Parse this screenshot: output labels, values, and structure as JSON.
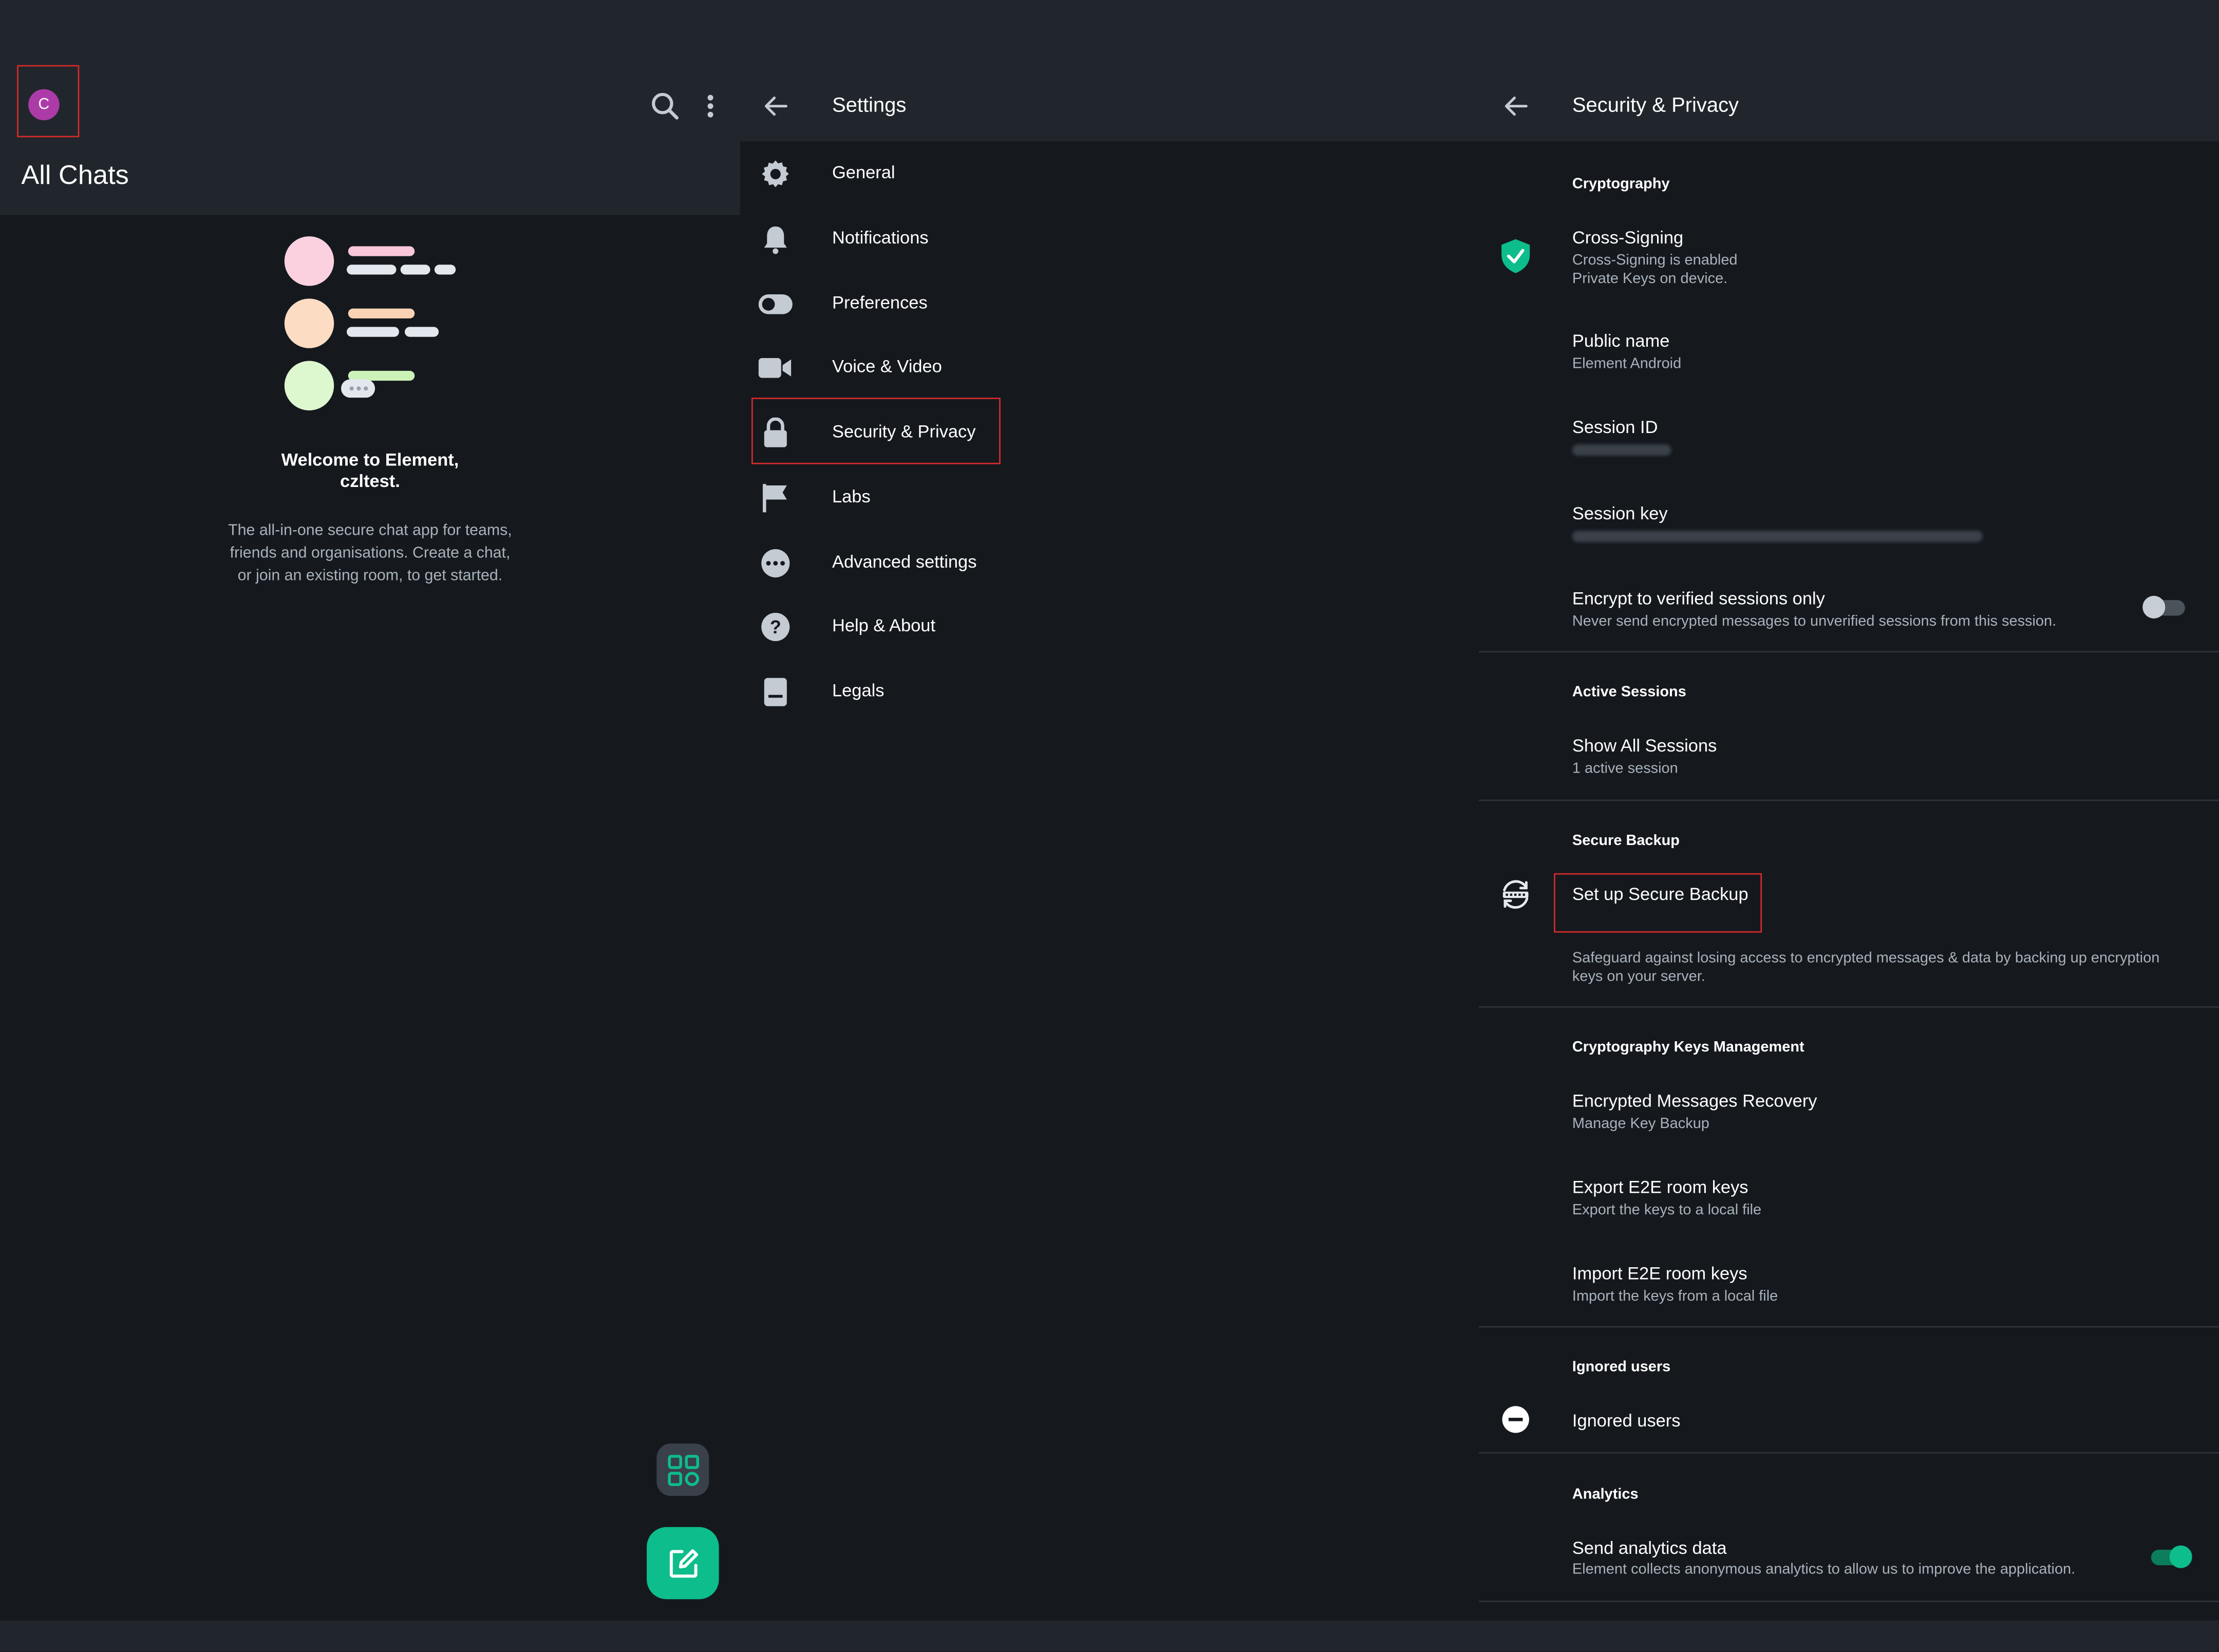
{
  "colors": {
    "background": "#15191e",
    "header": "#21262c",
    "accent": "#0dbd8b",
    "avatar": "#ac3ba8",
    "highlight_border": "#d42a2a",
    "secondary_text": "#a9b2bc"
  },
  "chats": {
    "avatar_letter": "C",
    "title": "All Chats",
    "welcome_title_line1": "Welcome to Element,",
    "welcome_title_line2": "czltest.",
    "welcome_body_line1": "The all-in-one secure chat app for teams,",
    "welcome_body_line2": "friends and organisations. Create a chat,",
    "welcome_body_line3": "or join an existing room, to get started."
  },
  "settings": {
    "title": "Settings",
    "items": [
      {
        "label": "General",
        "icon": "gear-icon"
      },
      {
        "label": "Notifications",
        "icon": "bell-icon"
      },
      {
        "label": "Preferences",
        "icon": "toggle-icon"
      },
      {
        "label": "Voice & Video",
        "icon": "video-icon"
      },
      {
        "label": "Security & Privacy",
        "icon": "lock-icon"
      },
      {
        "label": "Labs",
        "icon": "flag-icon"
      },
      {
        "label": "Advanced settings",
        "icon": "more-icon"
      },
      {
        "label": "Help & About",
        "icon": "help-icon"
      },
      {
        "label": "Legals",
        "icon": "document-icon"
      }
    ]
  },
  "security": {
    "title": "Security & Privacy",
    "cryptography_header": "Cryptography",
    "cross_signing_title": "Cross-Signing",
    "cross_signing_sub1": "Cross-Signing is enabled",
    "cross_signing_sub2": "Private Keys on device.",
    "public_name_title": "Public name",
    "public_name_value": "Element Android",
    "session_id_title": "Session ID",
    "session_key_title": "Session key",
    "encrypt_title": "Encrypt to verified sessions only",
    "encrypt_sub": "Never send encrypted messages to unverified sessions from this session.",
    "encrypt_enabled": false,
    "active_sessions_header": "Active Sessions",
    "show_sessions_title": "Show All Sessions",
    "show_sessions_sub": "1 active session",
    "secure_backup_header": "Secure Backup",
    "setup_backup_title": "Set up Secure Backup",
    "setup_backup_sub1": "Safeguard against losing access to encrypted messages & data by backing up encryption",
    "setup_backup_sub2": "keys on your server.",
    "keys_mgmt_header": "Cryptography Keys Management",
    "recovery_title": "Encrypted Messages Recovery",
    "recovery_sub": "Manage Key Backup",
    "export_title": "Export E2E room keys",
    "export_sub": "Export the keys to a local file",
    "import_title": "Import E2E room keys",
    "import_sub": "Import the keys from a local file",
    "ignored_header": "Ignored users",
    "ignored_title": "Ignored users",
    "analytics_header": "Analytics",
    "analytics_title": "Send analytics data",
    "analytics_sub": "Element collects anonymous analytics to allow us to improve the application.",
    "analytics_enabled": true
  }
}
